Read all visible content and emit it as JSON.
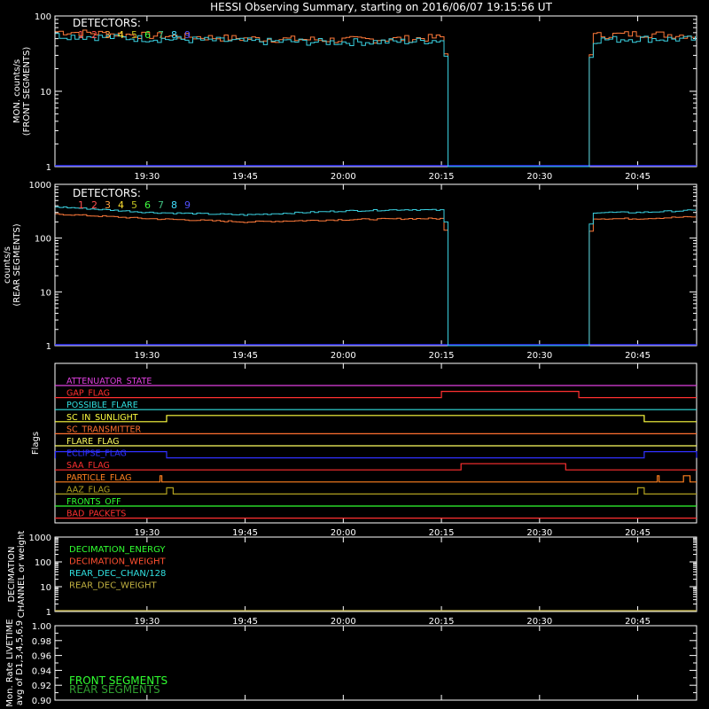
{
  "title": "HESSI Observing Summary, starting on 2016/06/07 19:15:56 UT",
  "time_labels": [
    "19:30",
    "19:45",
    "20:00",
    "20:15",
    "20:30",
    "20:45"
  ],
  "time_axis": {
    "start": "19:15:56",
    "end": "20:54:00",
    "tick_minutes": [
      30,
      45,
      60,
      75,
      90,
      105
    ]
  },
  "colors": {
    "front": "#ff7a3a",
    "rear": "#3ad0e0",
    "baseline": "#3030ff",
    "det": [
      "#ff5050",
      "#ff5050",
      "#ffa040",
      "#ffe030",
      "#c0c020",
      "#40ff40",
      "#40c080",
      "#40e0ff",
      "#5050ff"
    ]
  },
  "detectors": {
    "label": "DETECTORS:",
    "numbers": [
      "1",
      "2",
      "3",
      "4",
      "5",
      "6",
      "7",
      "8",
      "9"
    ]
  },
  "panels": {
    "front": {
      "ylabel_lines": [
        "MON. counts/s",
        "(FRONT SEGMENTS)"
      ],
      "y_ticks": [
        "1",
        "10",
        "100"
      ],
      "ylim": [
        1,
        100
      ]
    },
    "rear": {
      "ylabel_lines": [
        "counts/s",
        "(REAR SEGMENTS)"
      ],
      "y_ticks": [
        "1",
        "10",
        "100",
        "1000"
      ],
      "ylim": [
        1,
        1000
      ]
    },
    "flags": {
      "ylabel": "Flags",
      "items": [
        {
          "name": "ATTENUATOR_STATE",
          "color": "#e040e0"
        },
        {
          "name": "GAP_FLAG",
          "color": "#ff3030"
        },
        {
          "name": "POSSIBLE_FLARE",
          "color": "#30e0e0"
        },
        {
          "name": "SC_IN_SUNLIGHT",
          "color": "#ffff40"
        },
        {
          "name": "SC_TRANSMITTER",
          "color": "#ff7030"
        },
        {
          "name": "FLARE_FLAG",
          "color": "#ffff60"
        },
        {
          "name": "ECLIPSE_FLAG",
          "color": "#3030ff"
        },
        {
          "name": "SAA_FLAG",
          "color": "#ff3030"
        },
        {
          "name": "PARTICLE_FLAG",
          "color": "#ff8020"
        },
        {
          "name": "AAZ_FLAG",
          "color": "#b0a020"
        },
        {
          "name": "FRONTS_OFF",
          "color": "#30ff30"
        },
        {
          "name": "BAD_PACKETS",
          "color": "#ff3030"
        }
      ]
    },
    "decimation": {
      "ylabel_lines": [
        "DECIMATION",
        "CHANNEL or weight"
      ],
      "y_ticks": [
        "1",
        "10",
        "100",
        "1000"
      ],
      "ylim": [
        1,
        1000
      ],
      "legend": [
        {
          "name": "DECIMATION_ENERGY",
          "color": "#30ff30"
        },
        {
          "name": "DECIMATION_WEIGHT",
          "color": "#ff5030"
        },
        {
          "name": "REAR_DEC_CHAN/128",
          "color": "#30e0e0"
        },
        {
          "name": "REAR_DEC_WEIGHT",
          "color": "#c0b040"
        }
      ]
    },
    "livetime": {
      "ylabel_lines": [
        "Mon. Rate LIVETIME",
        "avg of D1,3,4,5,6,9"
      ],
      "y_ticks": [
        "0.90",
        "0.92",
        "0.94",
        "0.96",
        "0.98",
        "1.00"
      ],
      "ylim": [
        0.9,
        1.0
      ],
      "legend": [
        {
          "name": "FRONT SEGMENTS",
          "color": "#30ff30"
        },
        {
          "name": "REAR SEGMENTS",
          "color": "#30a030"
        }
      ]
    }
  },
  "chart_data": [
    {
      "type": "line",
      "title": "HESSI Observing Summary, starting on 2016/06/07 19:15:56 UT",
      "ylabel": "MON. counts/s (FRONT SEGMENTS)",
      "yscale": "log",
      "ylim": [
        1,
        100
      ],
      "gaps": [
        [
          "20:16",
          "20:37"
        ]
      ],
      "series": [
        {
          "x": [
            "19:16",
            "19:30",
            "19:45",
            "20:00",
            "20:10",
            "20:15",
            "20:16",
            "20:37",
            "20:38",
            "20:45",
            "20:54"
          ],
          "values": [
            62,
            55,
            50,
            48,
            50,
            52,
            1,
            1,
            55,
            58,
            55
          ]
        },
        {
          "x": [
            "19:16",
            "19:30",
            "19:45",
            "20:00",
            "20:10",
            "20:15",
            "20:16",
            "20:37",
            "20:38",
            "20:45",
            "20:54"
          ],
          "values": [
            55,
            50,
            46,
            45,
            46,
            48,
            1,
            1,
            48,
            50,
            49
          ]
        }
      ]
    },
    {
      "type": "line",
      "ylabel": "counts/s (REAR SEGMENTS)",
      "yscale": "log",
      "ylim": [
        1,
        1000
      ],
      "series": [
        {
          "x": [
            "19:16",
            "19:30",
            "19:45",
            "20:00",
            "20:10",
            "20:15",
            "20:16",
            "20:37",
            "20:38",
            "20:45",
            "20:54"
          ],
          "values": [
            280,
            230,
            200,
            220,
            230,
            230,
            1,
            1,
            230,
            230,
            250
          ]
        },
        {
          "x": [
            "19:16",
            "19:30",
            "19:45",
            "20:00",
            "20:10",
            "20:15",
            "20:16",
            "20:37",
            "20:38",
            "20:45",
            "20:54"
          ],
          "values": [
            380,
            300,
            270,
            320,
            340,
            330,
            1,
            1,
            300,
            300,
            330
          ]
        }
      ]
    },
    {
      "type": "line",
      "ylabel": "Flags",
      "series": [
        {
          "name": "GAP_FLAG",
          "on": [
            [
              "20:15",
              "20:36"
            ]
          ]
        },
        {
          "name": "SC_IN_SUNLIGHT",
          "on": [
            [
              "19:33",
              "20:46"
            ]
          ]
        },
        {
          "name": "ECLIPSE_FLAG",
          "on": [
            [
              "19:16",
              "19:33"
            ],
            [
              "20:46",
              "20:54"
            ]
          ]
        },
        {
          "name": "SAA_FLAG",
          "on": [
            [
              "20:18",
              "20:34"
            ]
          ]
        },
        {
          "name": "PARTICLE_FLAG",
          "on": [
            [
              "19:32",
              "19:32"
            ],
            [
              "20:48",
              "20:48"
            ],
            [
              "20:52",
              "20:53"
            ]
          ]
        },
        {
          "name": "AAZ_FLAG",
          "on": [
            [
              "19:33",
              "19:34"
            ],
            [
              "20:45",
              "20:46"
            ]
          ]
        }
      ]
    },
    {
      "type": "line",
      "ylabel": "DECIMATION CHANNEL or weight",
      "yscale": "log",
      "ylim": [
        1,
        1000
      ]
    },
    {
      "type": "line",
      "ylabel": "Mon. Rate LIVETIME avg of D1,3,4,5,6,9",
      "ylim": [
        0.9,
        1.0
      ]
    }
  ]
}
